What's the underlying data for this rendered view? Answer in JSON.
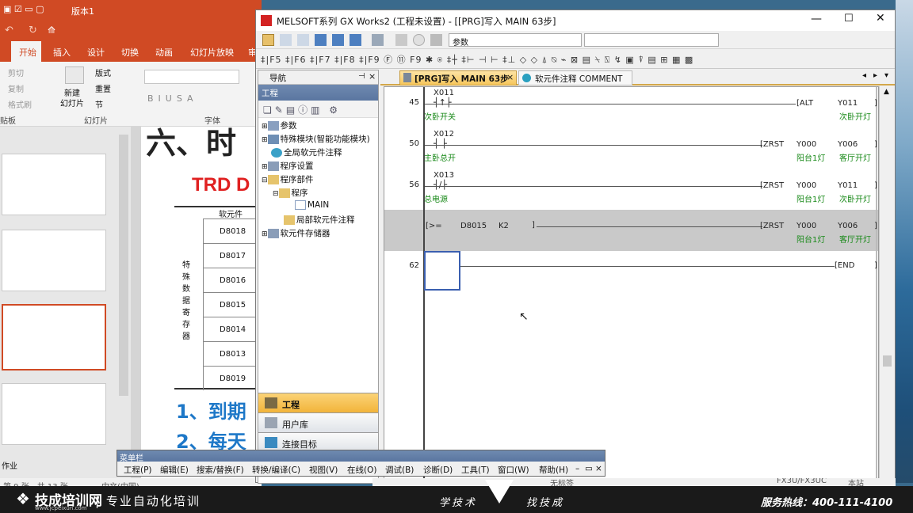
{
  "powerpoint": {
    "title_tab": "版本1",
    "ribbon_tabs": [
      "开始",
      "插入",
      "设计",
      "切换",
      "动画",
      "幻灯片放映",
      "审"
    ],
    "clipboard": {
      "cut": "剪切",
      "copy": "复制",
      "format_painter": "格式刷",
      "group": "贴板"
    },
    "slides_group": {
      "new_slide": "新建\n幻灯片",
      "layout": "版式",
      "reset": "重置",
      "section": "节",
      "group": "幻灯片"
    },
    "font_group": "字体",
    "slide_heading": "六、时",
    "slide_trd": "TRD D",
    "table_header": "软元件",
    "table_side_label": "特殊数据寄存器",
    "table_rows": [
      "D8018",
      "D8017",
      "D8016",
      "D8015",
      "D8014",
      "D8013",
      "D8019"
    ],
    "slide_line1": "1、到期",
    "slide_line2": "2、每天",
    "thumb_section_1": "作业",
    "thumb_section_2": "作业",
    "status": {
      "slide": "第 9 张，共 13 张",
      "lang": "中文(中国)"
    }
  },
  "gx": {
    "window_title": "MELSOFT系列 GX Works2 (工程未设置) - [[PRG]写入 MAIN 63步]",
    "toolbar_combo": "参数",
    "nav": {
      "header": "导航",
      "subheader": "工程",
      "tree": [
        {
          "label": "参数",
          "level": 0
        },
        {
          "label": "特殊模块(智能功能模块)",
          "level": 0
        },
        {
          "label": "全局软元件注释",
          "level": 0
        },
        {
          "label": "程序设置",
          "level": 0
        },
        {
          "label": "程序部件",
          "level": 0
        },
        {
          "label": "程序",
          "level": 1
        },
        {
          "label": "MAIN",
          "level": 2
        },
        {
          "label": "局部软元件注释",
          "level": 1
        },
        {
          "label": "软元件存储器",
          "level": 0
        }
      ],
      "bottom": [
        "工程",
        "用户库",
        "连接目标"
      ]
    },
    "tabs": [
      {
        "label": "[PRG]写入 MAIN 63步",
        "active": true
      },
      {
        "label": "软元件注释 COMMENT",
        "active": false
      }
    ],
    "rungs": [
      {
        "step": "45",
        "contact": "X011",
        "comment": "次卧开关",
        "instr": "ALT",
        "op1": "",
        "op2": "Y011",
        "op1c": "",
        "op2c": "次卧开灯"
      },
      {
        "step": "50",
        "contact": "X012",
        "comment": "主卧总开",
        "instr": "ZRST",
        "op1": "Y000",
        "op2": "Y006",
        "op1c": "阳台1灯",
        "op2c": "客厅开灯"
      },
      {
        "step": "56",
        "contact": "X013",
        "comment": "总电源",
        "instr": "ZRST",
        "op1": "Y000",
        "op2": "Y011",
        "op1c": "阳台1灯",
        "op2c": "次卧开灯"
      },
      {
        "step": "",
        "cmp": ">=",
        "cmpa": "D8015",
        "cmpb": "K2",
        "instr": "ZRST",
        "op1": "Y000",
        "op2": "Y006",
        "op1c": "阳台1灯",
        "op2c": "客厅开灯"
      },
      {
        "step": "62",
        "instr": "END"
      }
    ],
    "menubar": {
      "title": "菜单栏",
      "items": [
        "工程(P)",
        "编辑(E)",
        "搜索/替换(F)",
        "转换/编译(C)",
        "视图(V)",
        "在线(O)",
        "调试(B)",
        "诊断(D)",
        "工具(T)",
        "窗口(W)",
        "帮助(H)"
      ]
    },
    "status_right": [
      "无标签",
      "FX3U/FX3UC",
      "本站"
    ]
  },
  "footer": {
    "brand": "技成培训网",
    "brand_url": "www.jcpeixun.com",
    "slogan": "专业自动化培训",
    "mid_left": "学技术",
    "mid_right": "找技成",
    "hotline": "服务热线：400-111-4100"
  }
}
